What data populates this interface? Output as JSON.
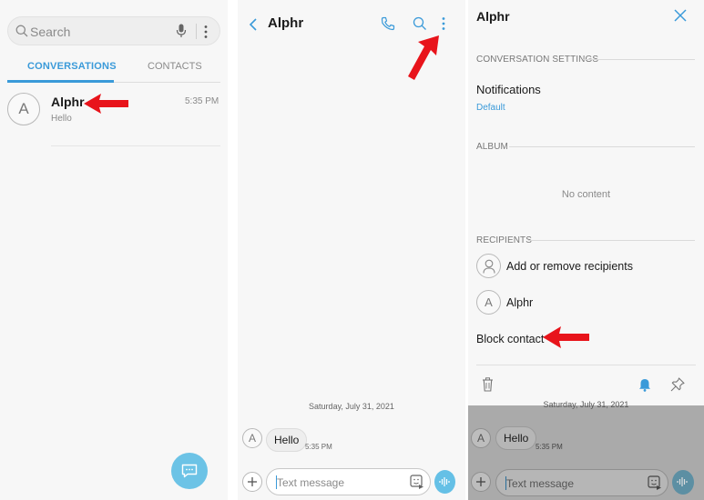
{
  "conversations_screen": {
    "search_placeholder": "Search",
    "tabs": [
      {
        "label": "CONVERSATIONS",
        "active": true
      },
      {
        "label": "CONTACTS",
        "active": false
      }
    ],
    "conversation": {
      "avatar_letter": "A",
      "name": "Alphr",
      "preview": "Hello",
      "time": "5:35 PM"
    },
    "fab_icon": "new-message-icon",
    "accent_color": "#3a9ad9"
  },
  "thread_screen": {
    "title": "Alphr",
    "date_separator": "Saturday, July 31, 2021",
    "message": {
      "avatar_letter": "A",
      "text": "Hello",
      "time": "5:35 PM"
    },
    "composer_placeholder": "Text message"
  },
  "settings_screen": {
    "title": "Alphr",
    "conversation_settings_header": "CONVERSATION SETTINGS",
    "notifications_label": "Notifications",
    "notifications_value": "Default",
    "album_header": "ALBUM",
    "album_empty": "No content",
    "recipients_header": "RECIPIENTS",
    "add_recipients_label": "Add or remove recipients",
    "recipient": {
      "avatar_letter": "A",
      "name": "Alphr"
    },
    "block_contact_label": "Block contact",
    "background_date": "Saturday, July 31, 2021",
    "background_message": {
      "avatar_letter": "A",
      "text": "Hello",
      "time": "5:35 PM"
    },
    "composer_placeholder": "Text message"
  },
  "annotation_color": "#e8141b"
}
